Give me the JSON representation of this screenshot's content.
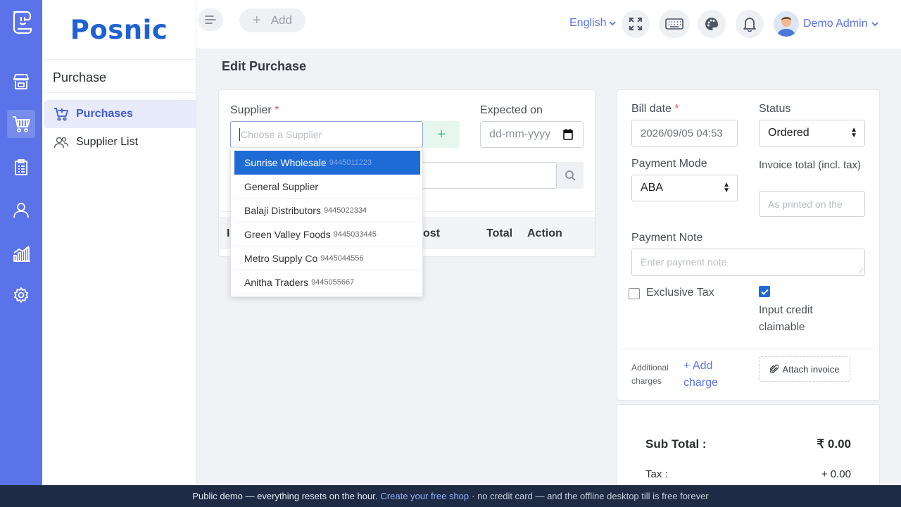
{
  "app": {
    "brand": "Posnic"
  },
  "rail": {
    "icons": [
      "logo-icon",
      "store-icon",
      "cart-icon",
      "clipboard-icon",
      "user-icon",
      "chart-icon",
      "settings-icon"
    ]
  },
  "sidebar": {
    "section_title": "Purchase",
    "items": [
      {
        "label": "Purchases",
        "icon": "cart-plus-icon",
        "active": true
      },
      {
        "label": "Supplier List",
        "icon": "users-icon",
        "active": false
      }
    ]
  },
  "topbar": {
    "add_label": "Add",
    "language": "English",
    "user_name": "Demo Admin"
  },
  "page": {
    "title": "Edit Purchase"
  },
  "form": {
    "supplier_label": "Supplier",
    "required_mark": "*",
    "supplier_placeholder": "Choose a Supplier",
    "add_supplier_symbol": "+",
    "expected_on_label": "Expected on",
    "expected_on_placeholder": "dd-mm-yyyy"
  },
  "supplier_options": [
    {
      "name": "Sunrise Wholesale",
      "phone": "9445011223",
      "selected": true
    },
    {
      "name": "General Supplier",
      "phone": "",
      "selected": false
    },
    {
      "name": "Balaji Distributors",
      "phone": "9445022334",
      "selected": false
    },
    {
      "name": "Green Valley Foods",
      "phone": "9445033445",
      "selected": false
    },
    {
      "name": "Metro Supply Co",
      "phone": "9445044556",
      "selected": false
    },
    {
      "name": "Anitha Traders",
      "phone": "9445055667",
      "selected": false
    }
  ],
  "items_table": {
    "headers": [
      "I",
      "ost",
      "Total",
      "Action"
    ]
  },
  "bill": {
    "bill_date_label": "Bill date",
    "bill_date_value": "2026/09/05 04:53",
    "status_label": "Status",
    "status_value": "Ordered",
    "payment_mode_label": "Payment Mode",
    "payment_mode_value": "ABA",
    "invoice_total_label": "Invoice total (incl. tax)",
    "invoice_total_placeholder": "As printed on the",
    "payment_note_label": "Payment Note",
    "payment_note_placeholder": "Enter payment note",
    "exclusive_tax_label": "Exclusive Tax",
    "exclusive_tax_checked": false,
    "input_credit_label": "Input credit claimable",
    "input_credit_checked": true,
    "additional_charges_label": "Additional charges",
    "add_charge_label": "+ Add charge",
    "attach_invoice_label": "Attach invoice"
  },
  "summary": {
    "sub_total_label": "Sub Total :",
    "sub_total_value": "₹ 0.00",
    "tax_label": "Tax :",
    "tax_value": "+ 0.00"
  },
  "footer": {
    "text_before": "Public demo — everything resets on the hour.",
    "link": "Create your free shop",
    "text_after": "· no credit card — and the offline desktop till is free forever"
  }
}
